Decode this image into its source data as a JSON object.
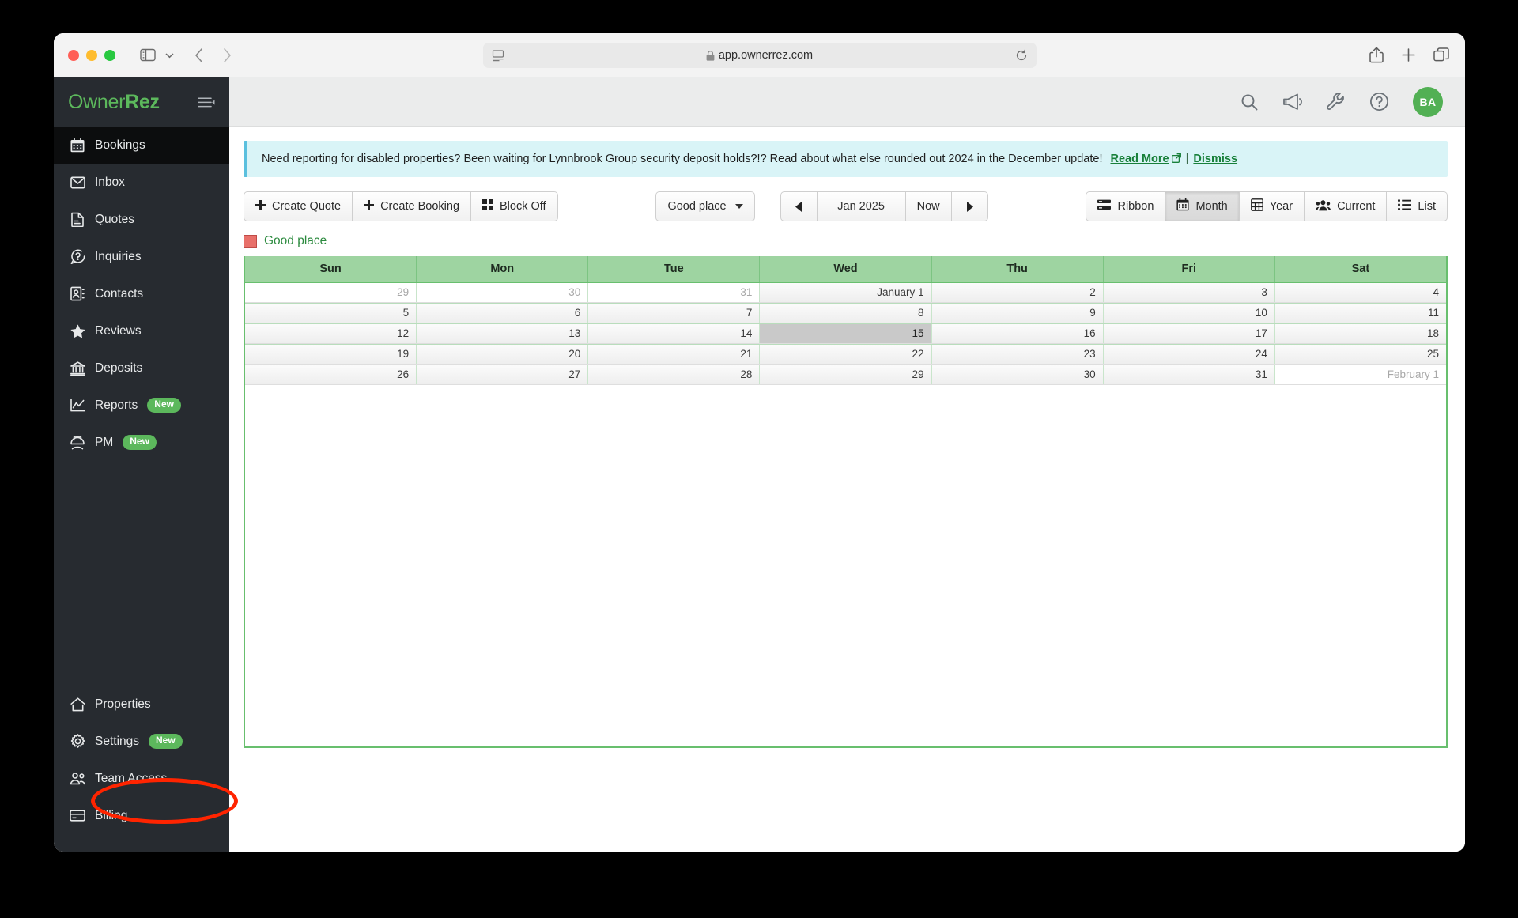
{
  "browser": {
    "url": "app.ownerrez.com",
    "traffic_lights": [
      "close",
      "minimize",
      "maximize"
    ],
    "icons": {
      "sidebar_toggle": "sidebar-toggle-icon",
      "sidebar_chevron": "chevron-down-icon",
      "back": "back-arrow-icon",
      "forward": "forward-arrow-icon",
      "reader": "reader-view-icon",
      "lock": "lock-icon",
      "reload": "reload-icon",
      "share": "share-icon",
      "new_tab": "plus-icon",
      "tab_overview": "tab-overview-icon"
    }
  },
  "sidebar": {
    "brand": {
      "first": "Owner",
      "second": "Rez"
    },
    "collapse_icon": "collapse-sidebar-icon",
    "items": [
      {
        "label": "Bookings",
        "icon": "calendar-icon",
        "active": true,
        "badge": ""
      },
      {
        "label": "Inbox",
        "icon": "envelope-icon",
        "active": false,
        "badge": ""
      },
      {
        "label": "Quotes",
        "icon": "document-icon",
        "active": false,
        "badge": ""
      },
      {
        "label": "Inquiries",
        "icon": "question-bubble-icon",
        "active": false,
        "badge": ""
      },
      {
        "label": "Contacts",
        "icon": "address-book-icon",
        "active": false,
        "badge": ""
      },
      {
        "label": "Reviews",
        "icon": "star-icon",
        "active": false,
        "badge": ""
      },
      {
        "label": "Deposits",
        "icon": "bank-icon",
        "active": false,
        "badge": ""
      },
      {
        "label": "Reports",
        "icon": "chart-line-icon",
        "active": false,
        "badge": "New"
      },
      {
        "label": "PM",
        "icon": "hard-hat-icon",
        "active": false,
        "badge": "New"
      }
    ],
    "bottom_items": [
      {
        "label": "Properties",
        "icon": "home-icon",
        "badge": ""
      },
      {
        "label": "Settings",
        "icon": "gear-icon",
        "badge": "New"
      },
      {
        "label": "Team Access",
        "icon": "users-icon",
        "badge": ""
      },
      {
        "label": "Billing",
        "icon": "credit-card-icon",
        "badge": ""
      }
    ],
    "annotation_color": "#ff2400",
    "annotation_target": "Settings"
  },
  "header": {
    "icons": [
      {
        "name": "search-icon"
      },
      {
        "name": "megaphone-icon"
      },
      {
        "name": "wrench-icon"
      },
      {
        "name": "help-circle-icon"
      }
    ],
    "avatar_initials": "BA",
    "avatar_color": "#52b054"
  },
  "notice": {
    "text": "Need reporting for disabled properties? Been waiting for Lynnbrook Group security deposit holds?!? Read about what else rounded out 2024 in the December update!",
    "read_more": "Read More",
    "separator": "|",
    "dismiss": "Dismiss",
    "accent_color": "#5bc0de"
  },
  "toolbar": {
    "create_quote": "Create Quote",
    "create_booking": "Create Booking",
    "block_off": "Block Off",
    "property": "Good place",
    "prev_label": "❮",
    "date_label": "Jan 2025",
    "now_label": "Now",
    "next_label": "❯",
    "views": [
      {
        "label": "Ribbon",
        "icon": "ribbon-icon",
        "active": false
      },
      {
        "label": "Month",
        "icon": "calendar-icon",
        "active": true
      },
      {
        "label": "Year",
        "icon": "grid-icon",
        "active": false
      },
      {
        "label": "Current",
        "icon": "people-icon",
        "active": false
      },
      {
        "label": "List",
        "icon": "list-icon",
        "active": false
      }
    ]
  },
  "legend": {
    "label": "Good place",
    "swatch_color": "#e8706a"
  },
  "calendar": {
    "day_headers": [
      "Sun",
      "Mon",
      "Tue",
      "Wed",
      "Thu",
      "Fri",
      "Sat"
    ],
    "header_color": "#9ed4a1",
    "today_color": "#fcfad0",
    "weeks": [
      [
        {
          "label": "29",
          "other": true,
          "today": false
        },
        {
          "label": "30",
          "other": true,
          "today": false
        },
        {
          "label": "31",
          "other": true,
          "today": false
        },
        {
          "label": "January 1",
          "other": false,
          "today": false
        },
        {
          "label": "2",
          "other": false,
          "today": false
        },
        {
          "label": "3",
          "other": false,
          "today": false
        },
        {
          "label": "4",
          "other": false,
          "today": false
        }
      ],
      [
        {
          "label": "5",
          "other": false,
          "today": false
        },
        {
          "label": "6",
          "other": false,
          "today": false
        },
        {
          "label": "7",
          "other": false,
          "today": false
        },
        {
          "label": "8",
          "other": false,
          "today": false
        },
        {
          "label": "9",
          "other": false,
          "today": false
        },
        {
          "label": "10",
          "other": false,
          "today": false
        },
        {
          "label": "11",
          "other": false,
          "today": false
        }
      ],
      [
        {
          "label": "12",
          "other": false,
          "today": false
        },
        {
          "label": "13",
          "other": false,
          "today": false
        },
        {
          "label": "14",
          "other": false,
          "today": false
        },
        {
          "label": "15",
          "other": false,
          "today": true
        },
        {
          "label": "16",
          "other": false,
          "today": false
        },
        {
          "label": "17",
          "other": false,
          "today": false
        },
        {
          "label": "18",
          "other": false,
          "today": false
        }
      ],
      [
        {
          "label": "19",
          "other": false,
          "today": false
        },
        {
          "label": "20",
          "other": false,
          "today": false
        },
        {
          "label": "21",
          "other": false,
          "today": false
        },
        {
          "label": "22",
          "other": false,
          "today": false
        },
        {
          "label": "23",
          "other": false,
          "today": false
        },
        {
          "label": "24",
          "other": false,
          "today": false
        },
        {
          "label": "25",
          "other": false,
          "today": false
        }
      ],
      [
        {
          "label": "26",
          "other": false,
          "today": false
        },
        {
          "label": "27",
          "other": false,
          "today": false
        },
        {
          "label": "28",
          "other": false,
          "today": false
        },
        {
          "label": "29",
          "other": false,
          "today": false
        },
        {
          "label": "30",
          "other": false,
          "today": false
        },
        {
          "label": "31",
          "other": false,
          "today": false
        },
        {
          "label": "February 1",
          "other": true,
          "today": false
        }
      ]
    ]
  }
}
